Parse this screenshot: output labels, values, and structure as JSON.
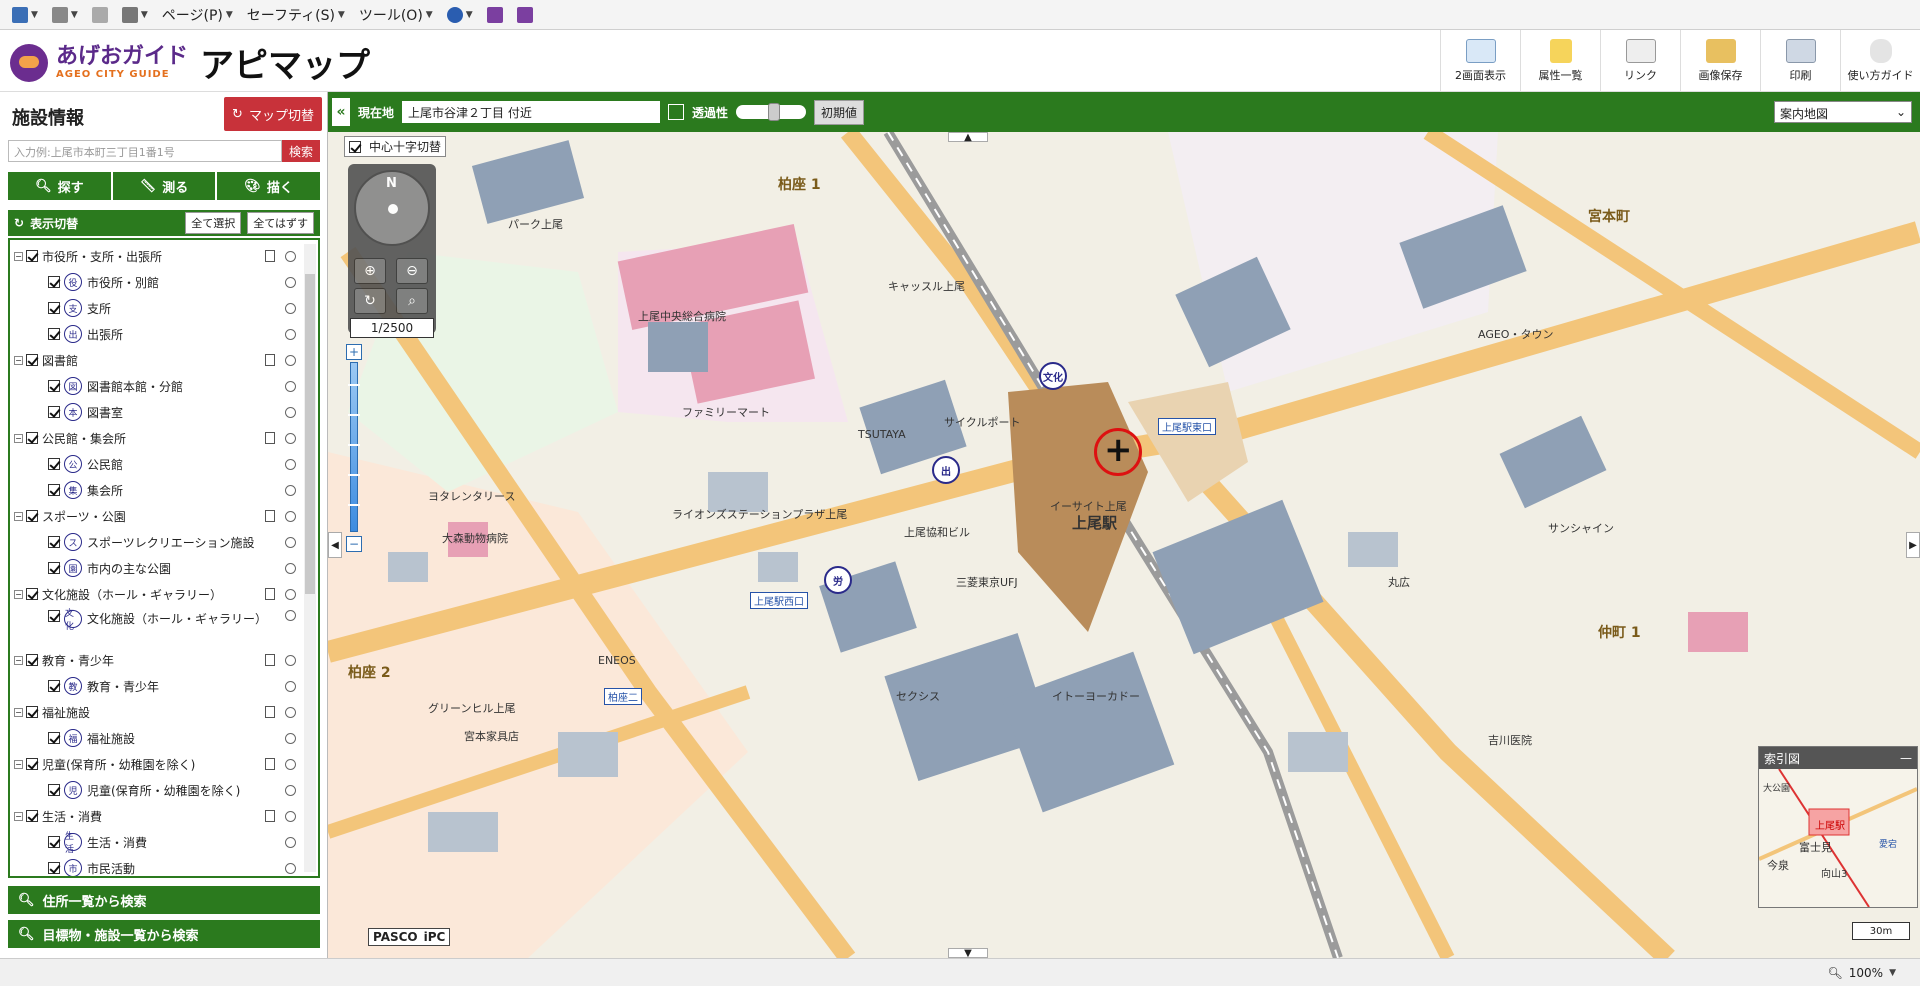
{
  "ie_toolbar": {
    "page": "ページ(P)",
    "safety": "セーフティ(S)",
    "tools": "ツール(O)"
  },
  "header": {
    "logo_main": "あげおガイド",
    "logo_sub": "AGEO CITY GUIDE",
    "app_title": "アピマップ",
    "tools": [
      {
        "label": "2画面表示",
        "icon": "split-screen-icon"
      },
      {
        "label": "属性一覧",
        "icon": "document-list-icon"
      },
      {
        "label": "リンク",
        "icon": "link-envelope-icon"
      },
      {
        "label": "画像保存",
        "icon": "folder-save-icon"
      },
      {
        "label": "印刷",
        "icon": "printer-icon"
      },
      {
        "label": "使い方ガイド",
        "icon": "mouse-guide-icon"
      }
    ]
  },
  "sidebar": {
    "title": "施設情報",
    "map_switch": "マップ切替",
    "search_placeholder": "入力例:上尾市本町三丁目1番1号",
    "search_button": "検索",
    "tabs": [
      "探す",
      "測る",
      "描く"
    ],
    "display_toggle": "表示切替",
    "select_all": "全て選択",
    "deselect_all": "全てはずす",
    "layers": [
      {
        "name": "市役所・支所・出張所",
        "items": [
          {
            "name": "市役所・別館",
            "icon": "役"
          },
          {
            "name": "支所",
            "icon": "支"
          },
          {
            "name": "出張所",
            "icon": "出"
          }
        ]
      },
      {
        "name": "図書館",
        "items": [
          {
            "name": "図書館本館・分館",
            "icon": "図"
          },
          {
            "name": "図書室",
            "icon": "本"
          }
        ]
      },
      {
        "name": "公民館・集会所",
        "items": [
          {
            "name": "公民館",
            "icon": "公"
          },
          {
            "name": "集会所",
            "icon": "集"
          }
        ]
      },
      {
        "name": "スポーツ・公園",
        "items": [
          {
            "name": "スポーツレクリエーション施設",
            "icon": "ス"
          },
          {
            "name": "市内の主な公園",
            "icon": "園"
          }
        ]
      },
      {
        "name": "文化施設（ホール・ギャラリー）",
        "items": [
          {
            "name": "文化施設（ホール・ギャラリー）",
            "icon": "文化"
          }
        ]
      },
      {
        "name": "教育・青少年",
        "items": [
          {
            "name": "教育・青少年",
            "icon": "教"
          }
        ]
      },
      {
        "name": "福祉施設",
        "items": [
          {
            "name": "福祉施設",
            "icon": "福"
          }
        ]
      },
      {
        "name": "児童(保育所・幼稚園を除く)",
        "items": [
          {
            "name": "児童(保育所・幼稚園を除く)",
            "icon": "児"
          }
        ]
      },
      {
        "name": "生活・消費",
        "items": [
          {
            "name": "生活・消費",
            "icon": "生活"
          },
          {
            "name": "市民活動",
            "icon": "市"
          }
        ]
      }
    ],
    "address_search": "住所一覧から検索",
    "landmark_search": "目標物・施設一覧から検索"
  },
  "map_header": {
    "current_location_label": "現在地",
    "current_location": "上尾市谷津２丁目 付近",
    "transparency": "透過性",
    "reset": "初期値",
    "map_type": "案内地図"
  },
  "map": {
    "crosshair_toggle": "中心十字切替",
    "scale": "1/2500",
    "overview_title": "索引図",
    "scale_bar": "30m",
    "attribution": [
      "PASCO",
      "iPC"
    ],
    "labels": {
      "kashiwaza1": "柏座 1",
      "kashiwaza2": "柏座 2",
      "miyamotocho": "宮本町",
      "nakamachi1": "仲町 1",
      "station": "上尾駅",
      "east_exit": "上尾駅東口",
      "west_exit": "上尾駅西口",
      "kashiwaza_ni": "柏座二",
      "hospital": "上尾中央総合病院",
      "tsutaya": "TSUTAYA",
      "aeon": "AGEO・タウン",
      "ito_yokado": "イトーヨーカドー",
      "seikushi": "セクシス",
      "eneos": "ENEOS",
      "maruhiro": "丸広",
      "aisaito": "イーサイト上尾",
      "sunshine": "サンシャイン",
      "park": "パーク上尾",
      "yotaretari": "ヨタレンタリース",
      "ohmori": "大森動物病院",
      "lions": "ライオンズステーションプラザ上尾",
      "ageo_kyowa": "上尾協和ビル",
      "family": "ファミリーマート",
      "tokyo": "三菱東京UFJ",
      "cycle": "サイクルポート",
      "family_kindergarten": "吉川医院",
      "shopping": "キャッスル上尾",
      "green_hill": "グリーンヒル上尾",
      "miyadai": "宮本家具店"
    },
    "overview_labels": [
      "上尾駅",
      "富士見",
      "今泉",
      "大公園",
      "愛宕",
      "向山3"
    ]
  },
  "status_bar": {
    "zoom": "100%"
  },
  "colors": {
    "green": "#2b7a1e",
    "red": "#c8323a",
    "road": "#f3c57a",
    "building": "#8fa0b5",
    "pink": "#e7a0b5"
  }
}
